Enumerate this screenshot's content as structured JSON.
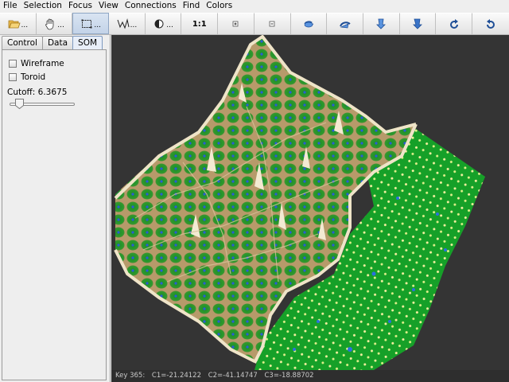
{
  "menu": [
    "File",
    "Selection",
    "Focus",
    "View",
    "Connections",
    "Find",
    "Colors"
  ],
  "toolbar": {
    "buttons": [
      {
        "icon": "folder-open-icon",
        "label": "..."
      },
      {
        "icon": "hand-pan-icon",
        "label": "..."
      },
      {
        "icon": "rect-select-icon",
        "label": "...",
        "active": true
      },
      {
        "icon": "lasso-select-icon",
        "label": "..."
      },
      {
        "icon": "contrast-icon",
        "label": "..."
      },
      {
        "icon": "zoom-one-icon",
        "label": "1:1"
      },
      {
        "icon": "zoom-in-icon",
        "label": ""
      },
      {
        "icon": "zoom-out-icon",
        "label": ""
      },
      {
        "icon": "rotate-left-icon",
        "label": ""
      },
      {
        "icon": "rotate-up-icon",
        "label": ""
      },
      {
        "icon": "rotate-down-icon",
        "label": ""
      },
      {
        "icon": "rotate-down-alt-icon",
        "label": ""
      },
      {
        "icon": "undo-rotate-icon",
        "label": ""
      },
      {
        "icon": "redo-rotate-icon",
        "label": ""
      }
    ]
  },
  "panel": {
    "tabs": [
      "Control",
      "Data",
      "SOM"
    ],
    "selected_tab": "SOM",
    "wireframe_label": "Wireframe",
    "toroid_label": "Toroid",
    "cutoff_label": "Cutoff: 6.3675",
    "cutoff_fraction": 0.1
  },
  "status": {
    "key": "Key 365:",
    "c1": "C1=-21.24122",
    "c2": "C2=-41.14747",
    "c3": "C3=-18.88702"
  },
  "colors": {
    "background": "#343434",
    "terrain_green": "#1f8a2a",
    "ridge": "#e8dcc0",
    "node_blue": "#2a5ad8",
    "node_yellow": "#f4f0a0"
  }
}
